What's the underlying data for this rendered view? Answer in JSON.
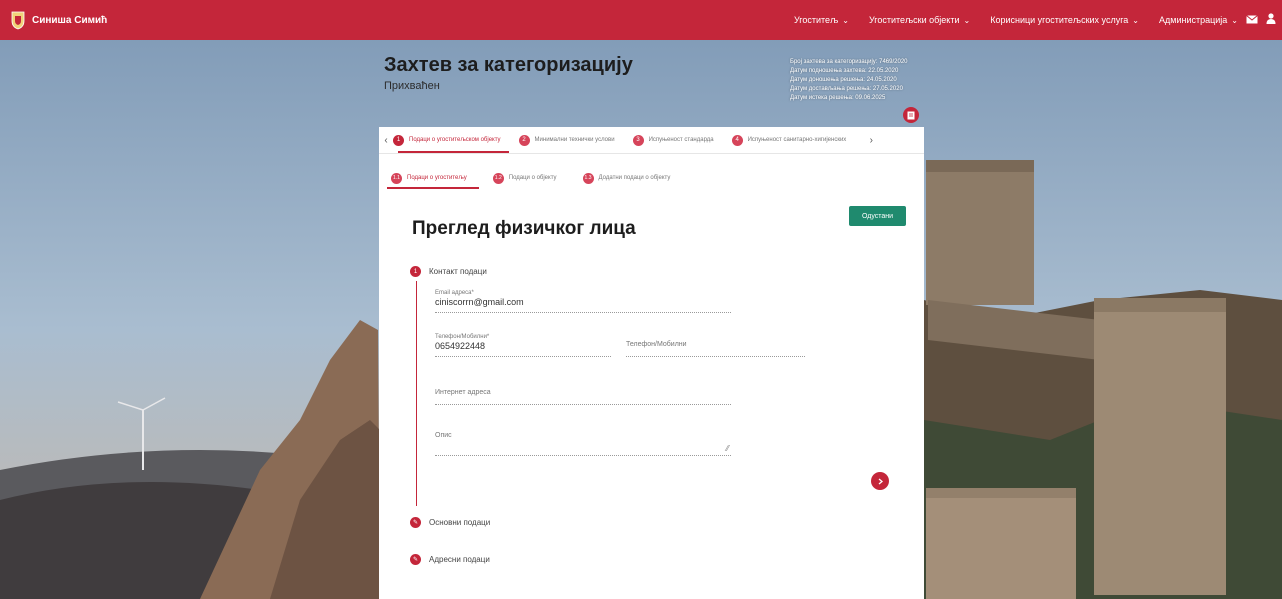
{
  "app": {
    "brand_name": "Синиша Симић"
  },
  "nav": {
    "items": [
      {
        "label": "Угоститељ"
      },
      {
        "label": "Угоститељски објекти"
      },
      {
        "label": "Корисници угоститељских услуга"
      },
      {
        "label": "Администрација"
      }
    ]
  },
  "header": {
    "title": "Захтев за категоризацију",
    "status": "Прихваћен",
    "meta": [
      "Број захтева за категоризацију: 7469/2020",
      "Датум подношења захтева: 22.05.2020",
      "Датум доношења решења: 24.05.2020",
      "Датум достављања решења: 27.05.2020",
      "Датум истека решења: 09.06.2025"
    ]
  },
  "steps": {
    "items": [
      {
        "num": "1",
        "label": "Подаци о угоститељском објекту"
      },
      {
        "num": "2",
        "label": "Минимални технички услови"
      },
      {
        "num": "3",
        "label": "Испуњеност стандарда"
      },
      {
        "num": "4",
        "label": "Испуњеност санитарно-хигијенских"
      }
    ]
  },
  "subtabs": {
    "items": [
      {
        "num": "1.1",
        "label": "Подаци о угоститељу"
      },
      {
        "num": "1.2",
        "label": "Подаци о објекту"
      },
      {
        "num": "1.3",
        "label": "Додатни подаци о објекту"
      }
    ]
  },
  "form": {
    "title": "Преглед физичког лица",
    "close_label": "Одустани",
    "sections": {
      "contact": {
        "num": "1",
        "label": "Контакт подаци"
      },
      "basic": {
        "label": "Основни подаци"
      },
      "address": {
        "label": "Адресни подаци"
      }
    },
    "fields": {
      "email": {
        "label": "Email адреса*",
        "value": "ciniscorrn@gmail.com"
      },
      "phone_mobile": {
        "label": "Телефон/Мобилни*",
        "value": "0654922448"
      },
      "phone_mobile_2": {
        "label": "Телефон/Мобилни"
      },
      "website": {
        "label": "Интернет адреса"
      },
      "description": {
        "label": "Опис"
      }
    }
  },
  "colors": {
    "accent": "#c4263a",
    "close_button": "#1f8a6e"
  }
}
